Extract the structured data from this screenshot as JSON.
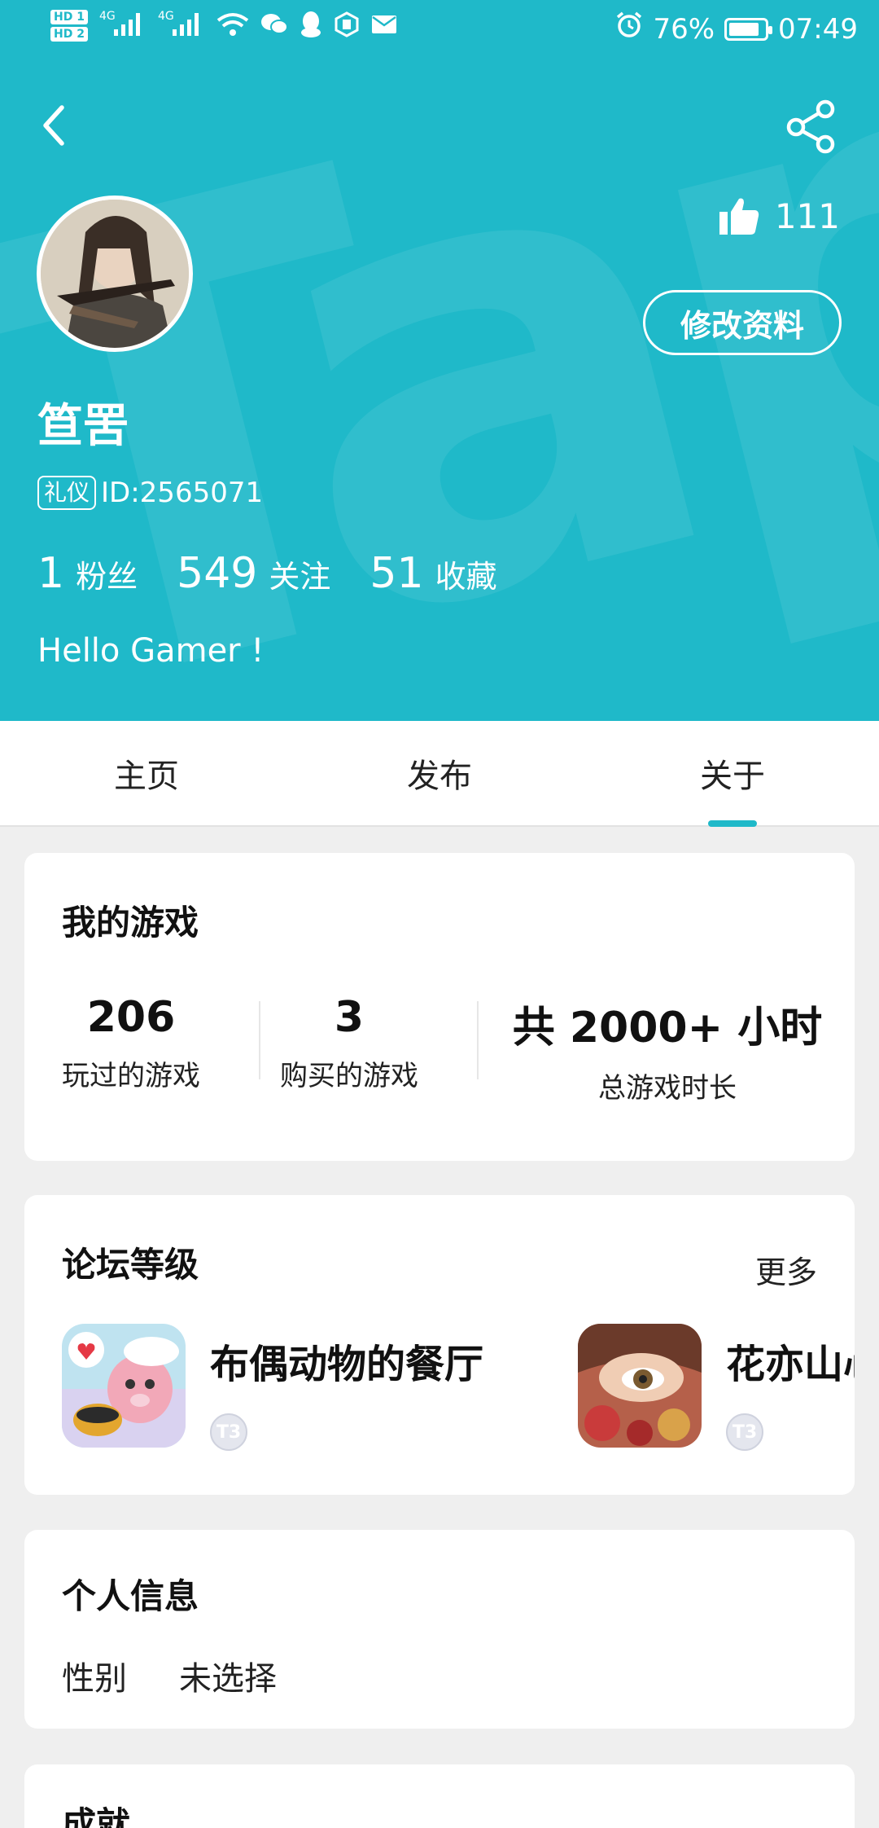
{
  "status_bar": {
    "hd1": "HD 1",
    "hd2": "HD 2",
    "signal1": "4G",
    "signal2": "4G",
    "battery": "76%",
    "time": "07:49"
  },
  "header": {
    "watermark": "TapTap",
    "likes": "111",
    "edit_label": "修改资料",
    "username": "笪罟",
    "tag": "礼仪",
    "id_text": "ID:2565071",
    "stats": [
      {
        "num": "1",
        "label": "粉丝"
      },
      {
        "num": "549",
        "label": "关注"
      },
      {
        "num": "51",
        "label": "收藏"
      }
    ],
    "bio": "Hello Gamer !",
    "bg_color": "#1fb9c9"
  },
  "tabs": [
    {
      "label": "主页"
    },
    {
      "label": "发布"
    },
    {
      "label": "关于"
    }
  ],
  "my_games": {
    "title": "我的游戏",
    "stats": [
      {
        "value": "206",
        "label": "玩过的游戏"
      },
      {
        "value": "3",
        "label": "购买的游戏"
      },
      {
        "value": "共 2000+ 小时",
        "label": "总游戏时长"
      }
    ]
  },
  "forum": {
    "title": "论坛等级",
    "more_label": "更多",
    "items": [
      {
        "name": "布偶动物的餐厅",
        "level": "T3"
      },
      {
        "name": "花亦山心之月",
        "level": "T3"
      }
    ]
  },
  "personal": {
    "title": "个人信息",
    "gender_label": "性别",
    "gender_value": "未选择"
  },
  "achievement": {
    "title": "成就"
  }
}
